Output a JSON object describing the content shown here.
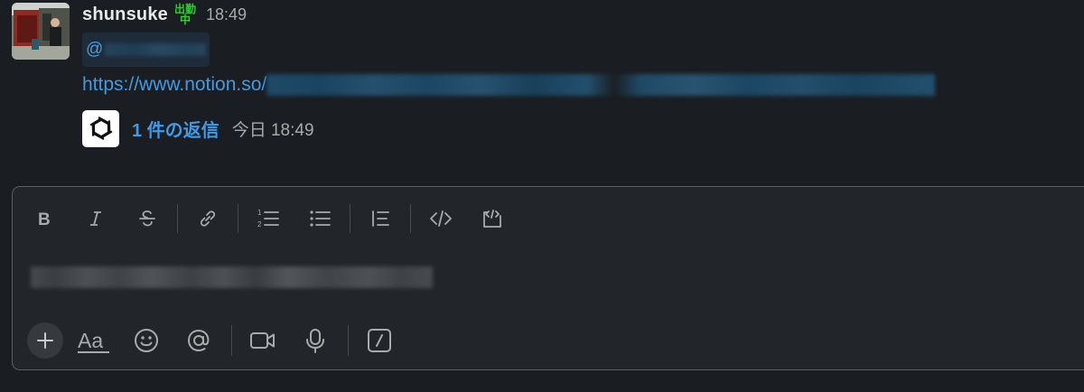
{
  "message": {
    "username": "shunsuke",
    "status_emoji": {
      "line1": "出勤",
      "line2": "中",
      "color": "#2bd42b"
    },
    "time": "18:49",
    "mention_prefix": "@",
    "link_prefix": "https://www.notion.so/"
  },
  "thread": {
    "reply_count_label": "1 件の返信",
    "last_reply_time": "今日 18:49",
    "avatar_icon": "openai-logo-icon"
  },
  "composer": {
    "format_toolbar": [
      {
        "name": "bold-icon"
      },
      {
        "name": "italic-icon"
      },
      {
        "name": "strikethrough-icon"
      },
      {
        "name": "link-icon"
      },
      {
        "name": "ordered-list-icon"
      },
      {
        "name": "bulleted-list-icon"
      },
      {
        "name": "blockquote-icon"
      },
      {
        "name": "code-icon"
      },
      {
        "name": "code-block-icon"
      }
    ],
    "bottom_toolbar": [
      {
        "name": "plus-icon"
      },
      {
        "name": "text-format-icon",
        "label": "Aa"
      },
      {
        "name": "emoji-icon"
      },
      {
        "name": "mention-icon"
      },
      {
        "name": "video-icon"
      },
      {
        "name": "microphone-icon"
      },
      {
        "name": "slash-command-icon"
      }
    ]
  },
  "colors": {
    "background": "#1a1d21",
    "link": "#3f9be6",
    "muted": "#a9aaab"
  }
}
